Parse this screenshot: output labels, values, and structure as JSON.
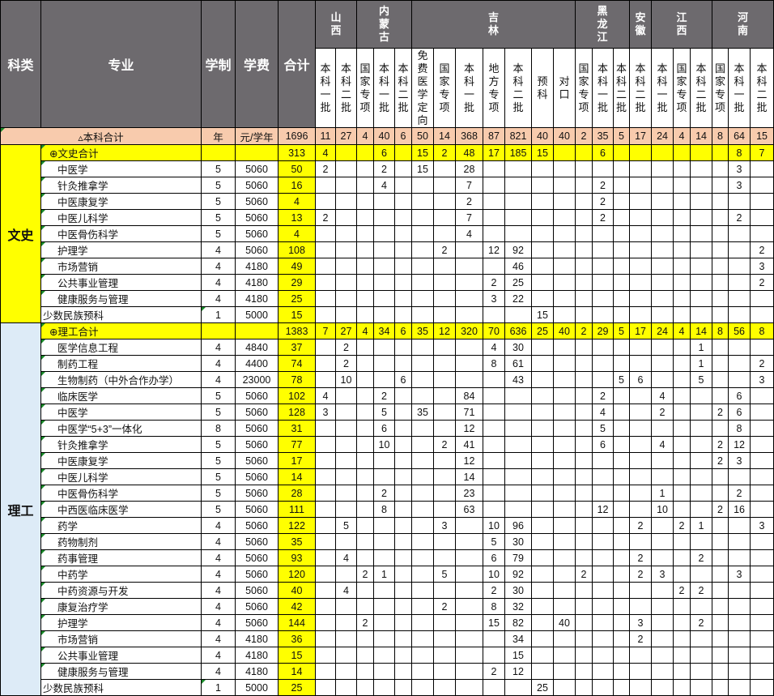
{
  "header": {
    "category": "科类",
    "major": "专业",
    "duration": "学制",
    "tuition": "学费",
    "total": "合计",
    "provinces": [
      {
        "name": "山西",
        "span": 2
      },
      {
        "name": "内蒙古",
        "span": 3
      },
      {
        "name": "吉林",
        "span": 7
      },
      {
        "name": "黑龙江",
        "span": 3
      },
      {
        "name": "安徽",
        "span": 1
      },
      {
        "name": "江西",
        "span": 3
      },
      {
        "name": "河南",
        "span": 3
      }
    ],
    "batches": [
      "本科一批",
      "本科二批",
      "国家专项",
      "本科一批",
      "本科二批",
      "免费医学定向",
      "国家专项",
      "本科一批",
      "地方专项",
      "本科二批",
      "预科",
      "对口",
      "国家专项",
      "本科一批",
      "本科二批",
      "本科二批",
      "本科一批",
      "国家专项",
      "本科二批",
      "国家专项",
      "本科一批",
      "本科二批"
    ]
  },
  "grand_total": {
    "label": "▵本科合计",
    "duration_unit": "年",
    "tuition_unit": "元/学年",
    "total": "1696",
    "values": [
      "11",
      "27",
      "4",
      "40",
      "6",
      "50",
      "14",
      "368",
      "87",
      "821",
      "40",
      "40",
      "2",
      "35",
      "5",
      "17",
      "24",
      "4",
      "14",
      "8",
      "64",
      "15"
    ]
  },
  "sections": [
    {
      "category": "文史",
      "subtotal": {
        "label": "⊕文史合计",
        "total": "313",
        "values": [
          "4",
          "",
          "",
          "6",
          "",
          "15",
          "2",
          "48",
          "17",
          "185",
          "15",
          "",
          "",
          "6",
          "",
          "",
          "",
          "",
          "",
          "",
          "8",
          "7"
        ]
      },
      "rows": [
        {
          "major": "中医学",
          "duration": "5",
          "tuition": "5060",
          "total": "50",
          "values": [
            "2",
            "",
            "",
            "2",
            "",
            "15",
            "",
            "28",
            "",
            "",
            "",
            "",
            "",
            "",
            "",
            "",
            "",
            "",
            "",
            "",
            "3",
            ""
          ]
        },
        {
          "major": "针灸推拿学",
          "duration": "5",
          "tuition": "5060",
          "total": "16",
          "values": [
            "",
            "",
            "",
            "4",
            "",
            "",
            "",
            "7",
            "",
            "",
            "",
            "",
            "",
            "2",
            "",
            "",
            "",
            "",
            "",
            "",
            "3",
            ""
          ]
        },
        {
          "major": "中医康复学",
          "duration": "5",
          "tuition": "5060",
          "total": "4",
          "values": [
            "",
            "",
            "",
            "",
            "",
            "",
            "",
            "2",
            "",
            "",
            "",
            "",
            "",
            "2",
            "",
            "",
            "",
            "",
            "",
            "",
            "",
            ""
          ]
        },
        {
          "major": "中医儿科学",
          "duration": "5",
          "tuition": "5060",
          "total": "13",
          "values": [
            "2",
            "",
            "",
            "",
            "",
            "",
            "",
            "7",
            "",
            "",
            "",
            "",
            "",
            "2",
            "",
            "",
            "",
            "",
            "",
            "",
            "2",
            ""
          ]
        },
        {
          "major": "中医骨伤科学",
          "duration": "5",
          "tuition": "5060",
          "total": "4",
          "values": [
            "",
            "",
            "",
            "",
            "",
            "",
            "",
            "4",
            "",
            "",
            "",
            "",
            "",
            "",
            "",
            "",
            "",
            "",
            "",
            "",
            "",
            ""
          ]
        },
        {
          "major": "护理学",
          "duration": "4",
          "tuition": "5060",
          "total": "108",
          "values": [
            "",
            "",
            "",
            "",
            "",
            "",
            "2",
            "",
            "12",
            "92",
            "",
            "",
            "",
            "",
            "",
            "",
            "",
            "",
            "",
            "",
            "",
            "2"
          ]
        },
        {
          "major": "市场营销",
          "duration": "4",
          "tuition": "4180",
          "total": "49",
          "values": [
            "",
            "",
            "",
            "",
            "",
            "",
            "",
            "",
            "",
            "46",
            "",
            "",
            "",
            "",
            "",
            "",
            "",
            "",
            "",
            "",
            "",
            "3"
          ]
        },
        {
          "major": "公共事业管理",
          "duration": "4",
          "tuition": "4180",
          "total": "29",
          "values": [
            "",
            "",
            "",
            "",
            "",
            "",
            "",
            "",
            "2",
            "25",
            "",
            "",
            "",
            "",
            "",
            "",
            "",
            "",
            "",
            "",
            "",
            "2"
          ]
        },
        {
          "major": "健康服务与管理",
          "duration": "4",
          "tuition": "4180",
          "total": "25",
          "values": [
            "",
            "",
            "",
            "",
            "",
            "",
            "",
            "",
            "3",
            "22",
            "",
            "",
            "",
            "",
            "",
            "",
            "",
            "",
            "",
            "",
            "",
            ""
          ]
        },
        {
          "major": "少数民族预科",
          "duration": "1",
          "tuition": "5000",
          "total": "15",
          "flush": true,
          "values": [
            "",
            "",
            "",
            "",
            "",
            "",
            "",
            "",
            "",
            "",
            "15",
            "",
            "",
            "",
            "",
            "",
            "",
            "",
            "",
            "",
            "",
            ""
          ]
        }
      ]
    },
    {
      "category": "理工",
      "subtotal": {
        "label": "⊕理工合计",
        "total": "1383",
        "values": [
          "7",
          "27",
          "4",
          "34",
          "6",
          "35",
          "12",
          "320",
          "70",
          "636",
          "25",
          "40",
          "2",
          "29",
          "5",
          "17",
          "24",
          "4",
          "14",
          "8",
          "56",
          "8"
        ]
      },
      "rows": [
        {
          "major": "医学信息工程",
          "duration": "4",
          "tuition": "4840",
          "total": "37",
          "values": [
            "",
            "2",
            "",
            "",
            "",
            "",
            "",
            "",
            "4",
            "30",
            "",
            "",
            "",
            "",
            "",
            "",
            "",
            "",
            "1",
            "",
            "",
            ""
          ]
        },
        {
          "major": "制药工程",
          "duration": "4",
          "tuition": "4400",
          "total": "74",
          "values": [
            "",
            "2",
            "",
            "",
            "",
            "",
            "",
            "",
            "8",
            "61",
            "",
            "",
            "",
            "",
            "",
            "",
            "",
            "",
            "1",
            "",
            "",
            "2"
          ]
        },
        {
          "major": "生物制药（中外合作办学）",
          "duration": "4",
          "tuition": "23000",
          "total": "78",
          "values": [
            "",
            "10",
            "",
            "",
            "6",
            "",
            "",
            "",
            "",
            "43",
            "",
            "",
            "",
            "",
            "5",
            "6",
            "",
            "",
            "5",
            "",
            "",
            "3"
          ]
        },
        {
          "major": "临床医学",
          "duration": "5",
          "tuition": "5060",
          "total": "102",
          "values": [
            "4",
            "",
            "",
            "2",
            "",
            "",
            "",
            "84",
            "",
            "",
            "",
            "",
            "",
            "2",
            "",
            "",
            "4",
            "",
            "",
            "",
            "6",
            ""
          ]
        },
        {
          "major": "中医学",
          "duration": "5",
          "tuition": "5060",
          "total": "128",
          "values": [
            "3",
            "",
            "",
            "5",
            "",
            "35",
            "",
            "71",
            "",
            "",
            "",
            "",
            "",
            "4",
            "",
            "",
            "2",
            "",
            "",
            "2",
            "6",
            ""
          ]
        },
        {
          "major": "中医学“5+3”一体化",
          "duration": "8",
          "tuition": "5060",
          "total": "31",
          "values": [
            "",
            "",
            "",
            "6",
            "",
            "",
            "",
            "12",
            "",
            "",
            "",
            "",
            "",
            "5",
            "",
            "",
            "",
            "",
            "",
            "",
            "8",
            ""
          ]
        },
        {
          "major": "针灸推拿学",
          "duration": "5",
          "tuition": "5060",
          "total": "77",
          "values": [
            "",
            "",
            "",
            "10",
            "",
            "",
            "2",
            "41",
            "",
            "",
            "",
            "",
            "",
            "6",
            "",
            "",
            "4",
            "",
            "",
            "2",
            "12",
            ""
          ]
        },
        {
          "major": "中医康复学",
          "duration": "5",
          "tuition": "5060",
          "total": "17",
          "values": [
            "",
            "",
            "",
            "",
            "",
            "",
            "",
            "12",
            "",
            "",
            "",
            "",
            "",
            "",
            "",
            "",
            "",
            "",
            "",
            "2",
            "3",
            ""
          ]
        },
        {
          "major": "中医儿科学",
          "duration": "5",
          "tuition": "5060",
          "total": "14",
          "values": [
            "",
            "",
            "",
            "",
            "",
            "",
            "",
            "14",
            "",
            "",
            "",
            "",
            "",
            "",
            "",
            "",
            "",
            "",
            "",
            "",
            "",
            ""
          ]
        },
        {
          "major": "中医骨伤科学",
          "duration": "5",
          "tuition": "5060",
          "total": "28",
          "values": [
            "",
            "",
            "",
            "2",
            "",
            "",
            "",
            "23",
            "",
            "",
            "",
            "",
            "",
            "",
            "",
            "",
            "1",
            "",
            "",
            "",
            "2",
            ""
          ]
        },
        {
          "major": "中西医临床医学",
          "duration": "5",
          "tuition": "5060",
          "total": "111",
          "values": [
            "",
            "",
            "",
            "8",
            "",
            "",
            "",
            "63",
            "",
            "",
            "",
            "",
            "",
            "12",
            "",
            "",
            "10",
            "",
            "",
            "2",
            "16",
            ""
          ]
        },
        {
          "major": "药学",
          "duration": "4",
          "tuition": "5060",
          "total": "122",
          "values": [
            "",
            "5",
            "",
            "",
            "",
            "",
            "3",
            "",
            "10",
            "96",
            "",
            "",
            "",
            "",
            "",
            "2",
            "",
            "2",
            "1",
            "",
            "",
            "3"
          ]
        },
        {
          "major": "药物制剂",
          "duration": "4",
          "tuition": "5060",
          "total": "35",
          "values": [
            "",
            "",
            "",
            "",
            "",
            "",
            "",
            "",
            "5",
            "30",
            "",
            "",
            "",
            "",
            "",
            "",
            "",
            "",
            "",
            "",
            "",
            ""
          ]
        },
        {
          "major": "药事管理",
          "duration": "4",
          "tuition": "5060",
          "total": "93",
          "values": [
            "",
            "4",
            "",
            "",
            "",
            "",
            "",
            "",
            "6",
            "79",
            "",
            "",
            "",
            "",
            "",
            "2",
            "",
            "",
            "2",
            "",
            "",
            ""
          ]
        },
        {
          "major": "中药学",
          "duration": "4",
          "tuition": "5060",
          "total": "120",
          "values": [
            "",
            "",
            "2",
            "1",
            "",
            "",
            "5",
            "",
            "10",
            "92",
            "",
            "",
            "2",
            "",
            "",
            "2",
            "3",
            "",
            "",
            "",
            "3",
            ""
          ]
        },
        {
          "major": "中药资源与开发",
          "duration": "4",
          "tuition": "5060",
          "total": "40",
          "values": [
            "",
            "4",
            "",
            "",
            "",
            "",
            "",
            "",
            "2",
            "30",
            "",
            "",
            "",
            "",
            "",
            "",
            "",
            "2",
            "2",
            "",
            "",
            ""
          ]
        },
        {
          "major": "康复治疗学",
          "duration": "4",
          "tuition": "5060",
          "total": "42",
          "values": [
            "",
            "",
            "",
            "",
            "",
            "",
            "2",
            "",
            "8",
            "32",
            "",
            "",
            "",
            "",
            "",
            "",
            "",
            "",
            "",
            "",
            "",
            ""
          ]
        },
        {
          "major": "护理学",
          "duration": "4",
          "tuition": "5060",
          "total": "144",
          "values": [
            "",
            "",
            "2",
            "",
            "",
            "",
            "",
            "",
            "15",
            "82",
            "",
            "40",
            "",
            "",
            "",
            "3",
            "",
            "",
            "2",
            "",
            "",
            ""
          ]
        },
        {
          "major": "市场营销",
          "duration": "4",
          "tuition": "4180",
          "total": "36",
          "values": [
            "",
            "",
            "",
            "",
            "",
            "",
            "",
            "",
            "",
            "34",
            "",
            "",
            "",
            "",
            "",
            "2",
            "",
            "",
            "",
            "",
            "",
            ""
          ]
        },
        {
          "major": "公共事业管理",
          "duration": "4",
          "tuition": "4180",
          "total": "15",
          "values": [
            "",
            "",
            "",
            "",
            "",
            "",
            "",
            "",
            "",
            "15",
            "",
            "",
            "",
            "",
            "",
            "",
            "",
            "",
            "",
            "",
            "",
            ""
          ]
        },
        {
          "major": "健康服务与管理",
          "duration": "4",
          "tuition": "4180",
          "total": "14",
          "values": [
            "",
            "",
            "",
            "",
            "",
            "",
            "",
            "",
            "2",
            "12",
            "",
            "",
            "",
            "",
            "",
            "",
            "",
            "",
            "",
            "",
            "",
            ""
          ]
        },
        {
          "major": "少数民族预科",
          "duration": "1",
          "tuition": "5000",
          "total": "25",
          "flush": true,
          "values": [
            "",
            "",
            "",
            "",
            "",
            "",
            "",
            "",
            "",
            "",
            "25",
            "",
            "",
            "",
            "",
            "",
            "",
            "",
            "",
            "",
            "",
            ""
          ]
        }
      ]
    }
  ],
  "colors": {
    "header_bg": "#6d6a6e",
    "grand_total_bg": "#f8cbad",
    "subtotal_bg": "#ffff00",
    "wenshi_bg": "#e2efda",
    "ligong_bg": "#ddebf7"
  }
}
